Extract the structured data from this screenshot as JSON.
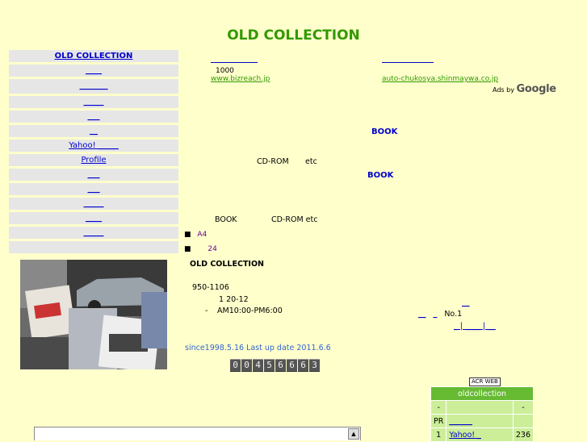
{
  "page": {
    "title": "OLD COLLECTION"
  },
  "nav": {
    "items": [
      {
        "label": "OLD COLLECTION"
      },
      {
        "label": "____"
      },
      {
        "label": "_______"
      },
      {
        "label": "_____"
      },
      {
        "label": "___"
      },
      {
        "label": "__"
      },
      {
        "label": "Yahoo! _____"
      },
      {
        "label": "Profile"
      },
      {
        "label": "___"
      },
      {
        "label": "___"
      },
      {
        "label": "_____"
      },
      {
        "label": "____"
      },
      {
        "label": "_____"
      },
      {
        "label": ""
      }
    ]
  },
  "ads": {
    "left": {
      "headline": "________",
      "body": "1000",
      "url": "www.bizreach.jp"
    },
    "right": {
      "headline": "__________",
      "body": "",
      "url": "auto-chukosya.shinmaywa.co.jp"
    },
    "ads_by": "Ads by",
    "brand": "Google"
  },
  "content": {
    "book_link_1": "BOOK",
    "line_cdrom": "CD-ROM",
    "line_etc": "etc",
    "book_link_2": "BOOK",
    "line_book": "BOOK",
    "line_cdrom_etc": "CD-ROM etc",
    "bullet_1": "A4",
    "bullet_2": "24",
    "shop_name": "OLD COLLECTION",
    "zip": "950-1106",
    "address": "1  20-12",
    "hours_prefix": "-",
    "hours": "AM10:00-PM6:00",
    "since": "since1998.5.16  Last up date 2011.6.6"
  },
  "right_links": {
    "top": "__",
    "row2_a": "__",
    "row2_b": "_",
    "row2_text": "No.1",
    "row3": "_ | ____ | __"
  },
  "counter": {
    "digits": [
      "0",
      "0",
      "4",
      "5",
      "6",
      "6",
      "6",
      "3"
    ]
  },
  "rank": {
    "acr_label": "ACR WEB",
    "header": "oldcollection",
    "rows": [
      {
        "no": "-",
        "name": "",
        "count": "-"
      },
      {
        "no": "PR",
        "name": "______",
        "count": ""
      },
      {
        "no": "1",
        "name": "Yahoo! _",
        "count": "236"
      }
    ]
  },
  "colors": {
    "background": "#ffffcc",
    "title": "#339900",
    "link": "#0000cc",
    "nav_bg": "#e6e6e6",
    "rank_header": "#66bb33",
    "rank_row": "#ccee99"
  }
}
